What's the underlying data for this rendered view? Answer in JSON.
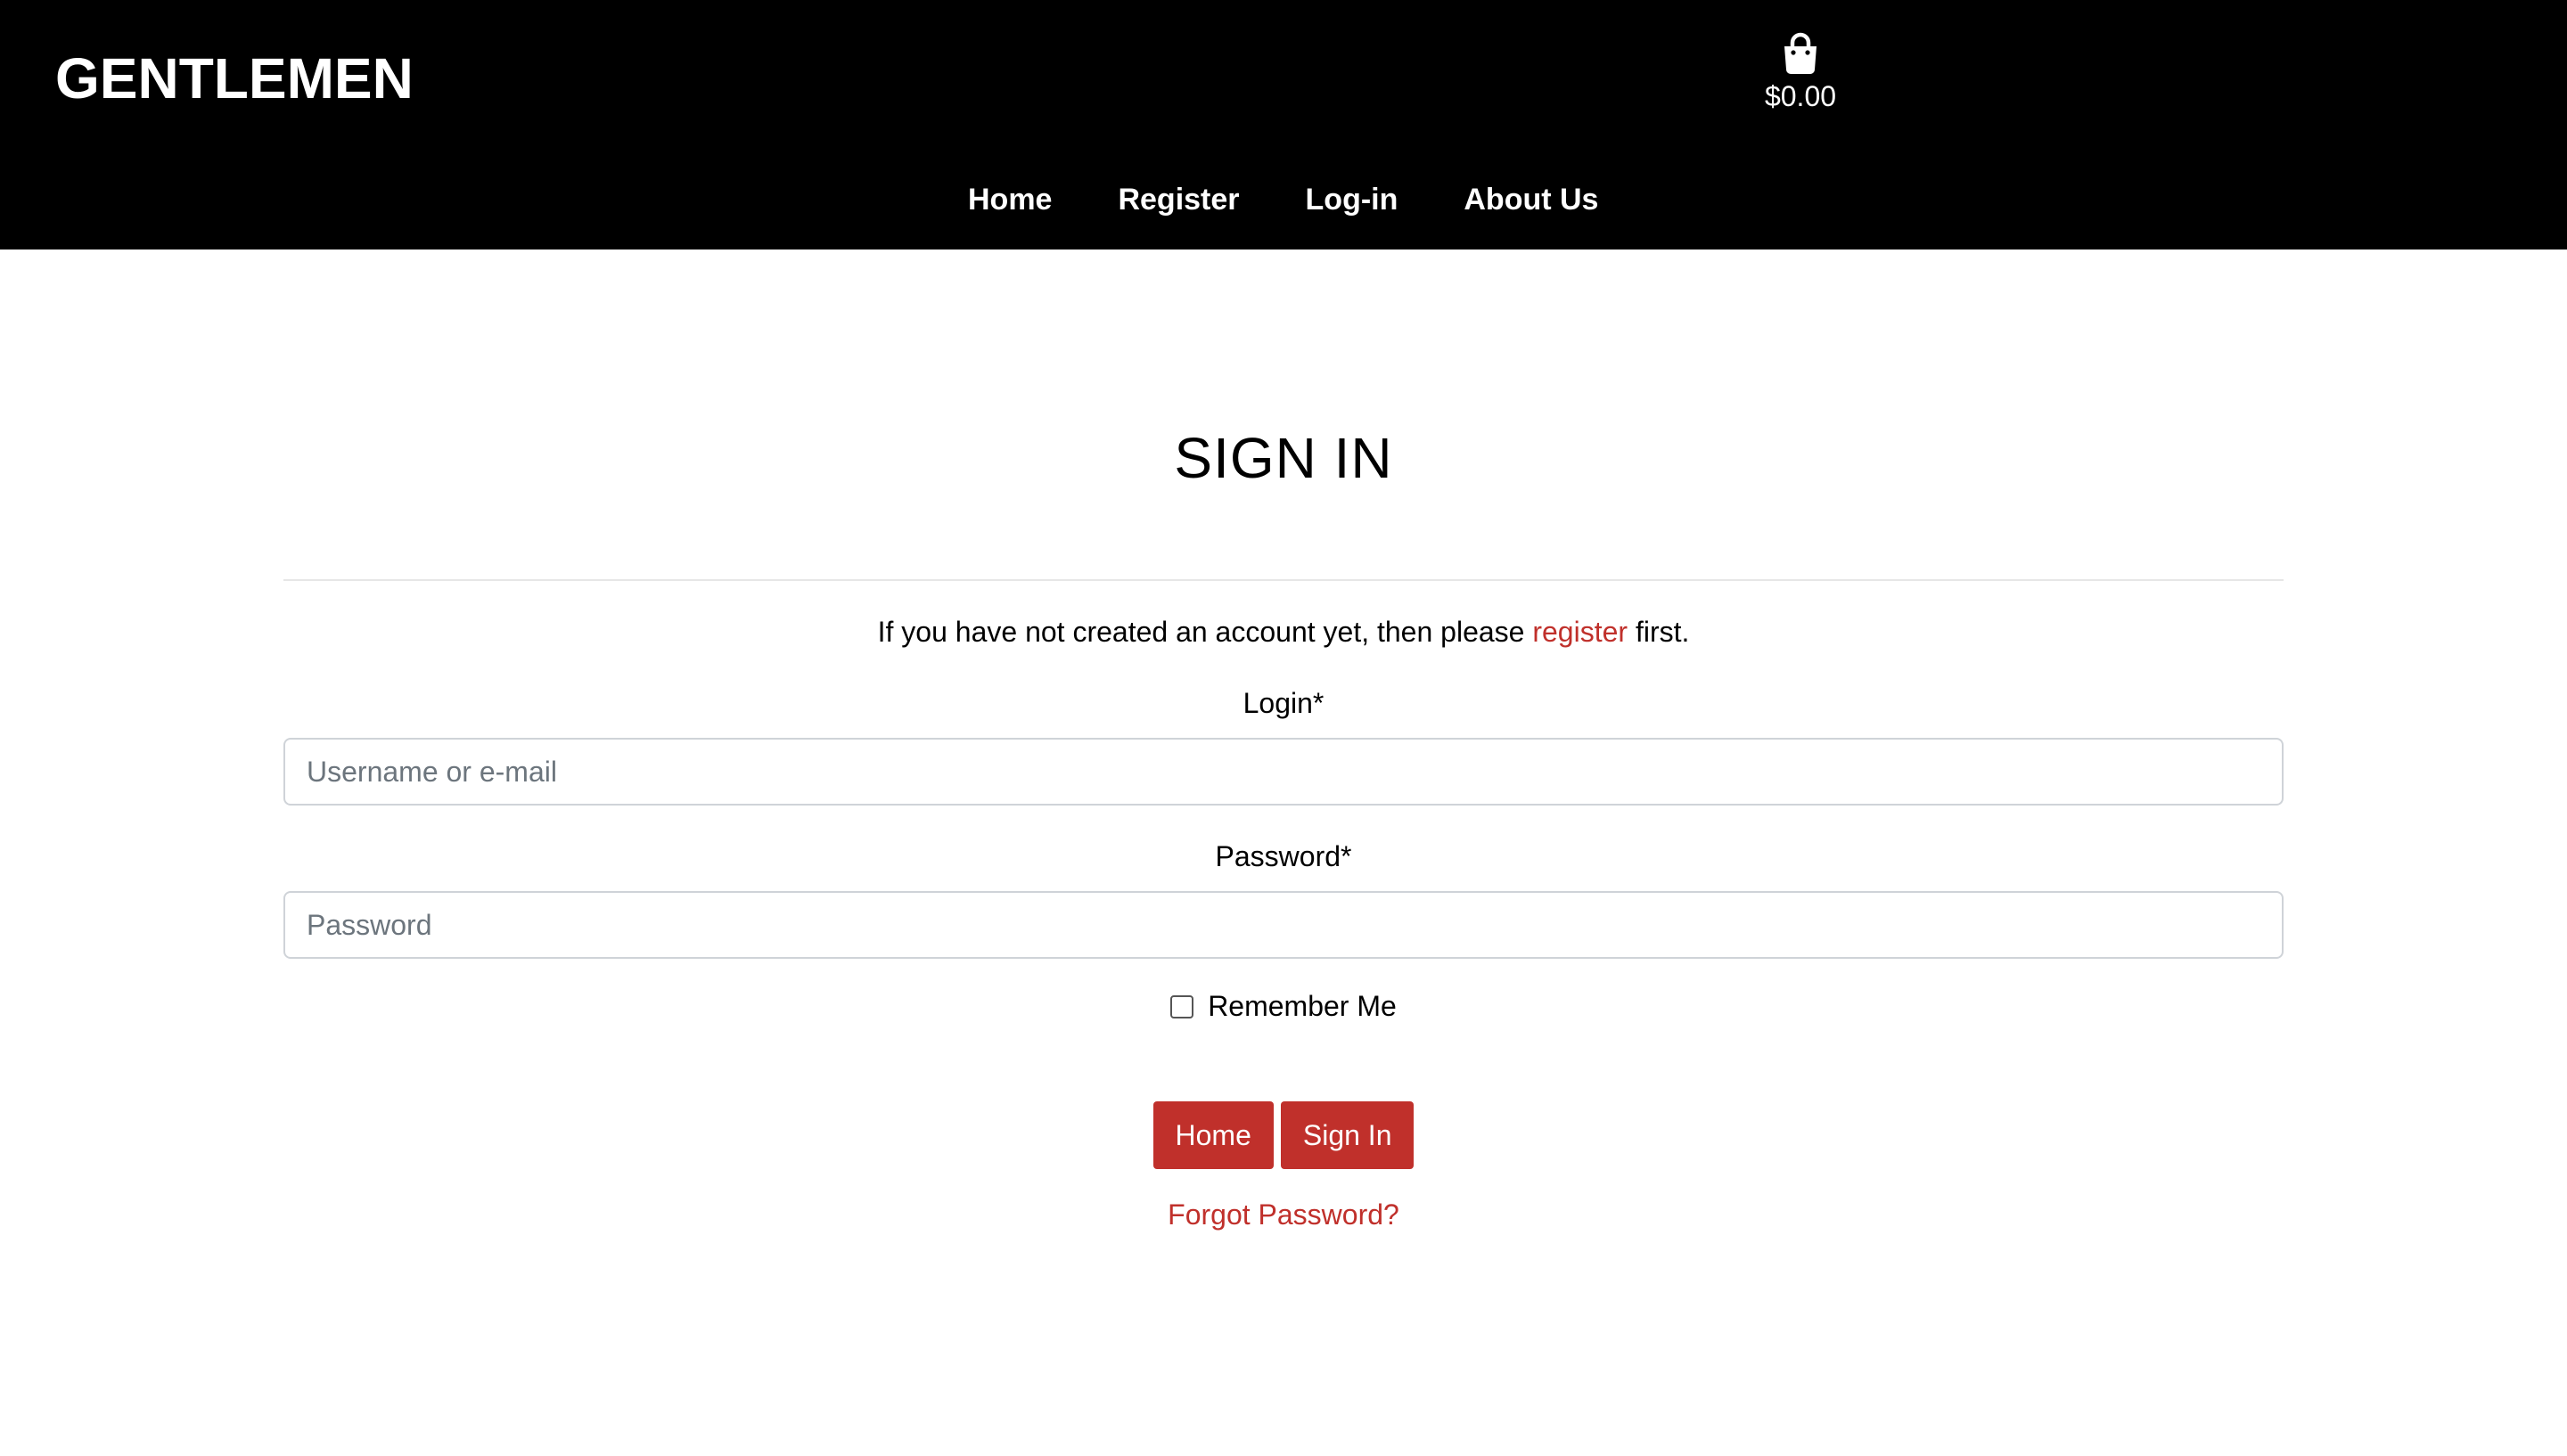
{
  "header": {
    "brand": "GENTLEMEN",
    "cart_icon": "shopping-bag-icon",
    "cart_total": "$0.00",
    "nav": [
      {
        "label": "Home"
      },
      {
        "label": "Register"
      },
      {
        "label": "Log-in"
      },
      {
        "label": "About Us"
      }
    ]
  },
  "main": {
    "title": "SIGN IN",
    "intro": {
      "before": "If you have not created an account yet, then please ",
      "link": "register",
      "after": " first."
    },
    "login": {
      "label": "Login*",
      "placeholder": "Username or e-mail",
      "value": ""
    },
    "password": {
      "label": "Password*",
      "placeholder": "Password",
      "value": ""
    },
    "remember": {
      "label": "Remember Me",
      "checked": false
    },
    "buttons": {
      "home": "Home",
      "sign_in": "Sign In"
    },
    "forgot": "Forgot Password?"
  },
  "colors": {
    "header_bg": "#000000",
    "accent": "#c0302b",
    "text": "#000000"
  }
}
